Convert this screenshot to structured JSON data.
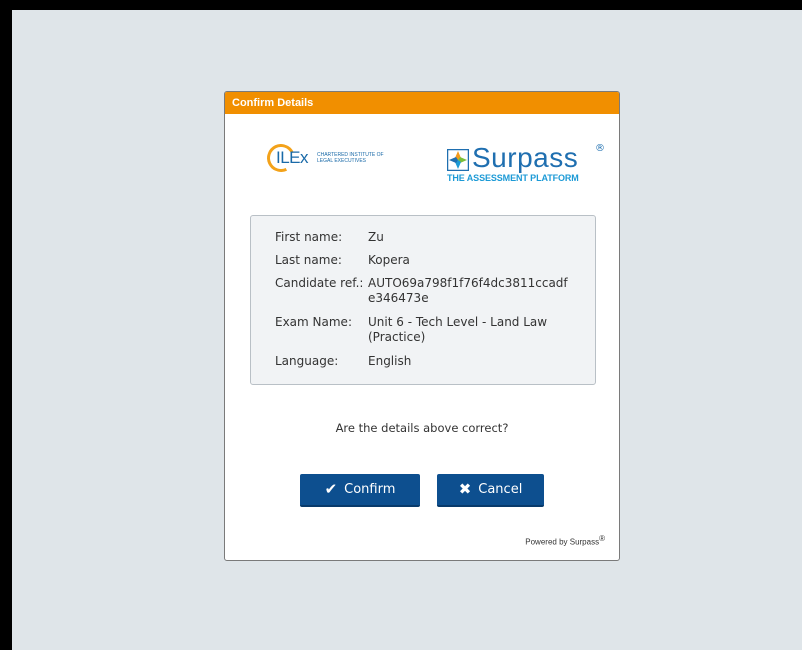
{
  "dialog": {
    "title": "Confirm Details",
    "logos": {
      "ilex": {
        "word": "ILEx",
        "subtitle": "CHARTERED INSTITUTE OF LEGAL EXECUTIVES"
      },
      "surpass": {
        "word": "Surpass",
        "registered": "®",
        "tagline": "THE ASSESSMENT PLATFORM"
      }
    },
    "details": [
      {
        "label": "First name:",
        "value": "Zu"
      },
      {
        "label": "Last name:",
        "value": "Kopera"
      },
      {
        "label": "Candidate ref.:",
        "value": "AUTO69a798f1f76f4dc3811ccadfe346473e"
      },
      {
        "label": "Exam Name:",
        "value": "Unit 6 - Tech Level - Land Law (Practice)"
      },
      {
        "label": "Language:",
        "value": "English"
      }
    ],
    "question": "Are the details above correct?",
    "buttons": {
      "confirm": {
        "label": "Confirm",
        "icon": "check-icon"
      },
      "cancel": {
        "label": "Cancel",
        "icon": "x-icon"
      }
    },
    "footer": {
      "powered_by": "Powered by Surpass",
      "registered": "®"
    }
  },
  "colors": {
    "titlebar": "#f18f00",
    "button": "#0d4f8f",
    "background": "#dfe5e9",
    "surpass_blue": "#1f6fb0"
  }
}
